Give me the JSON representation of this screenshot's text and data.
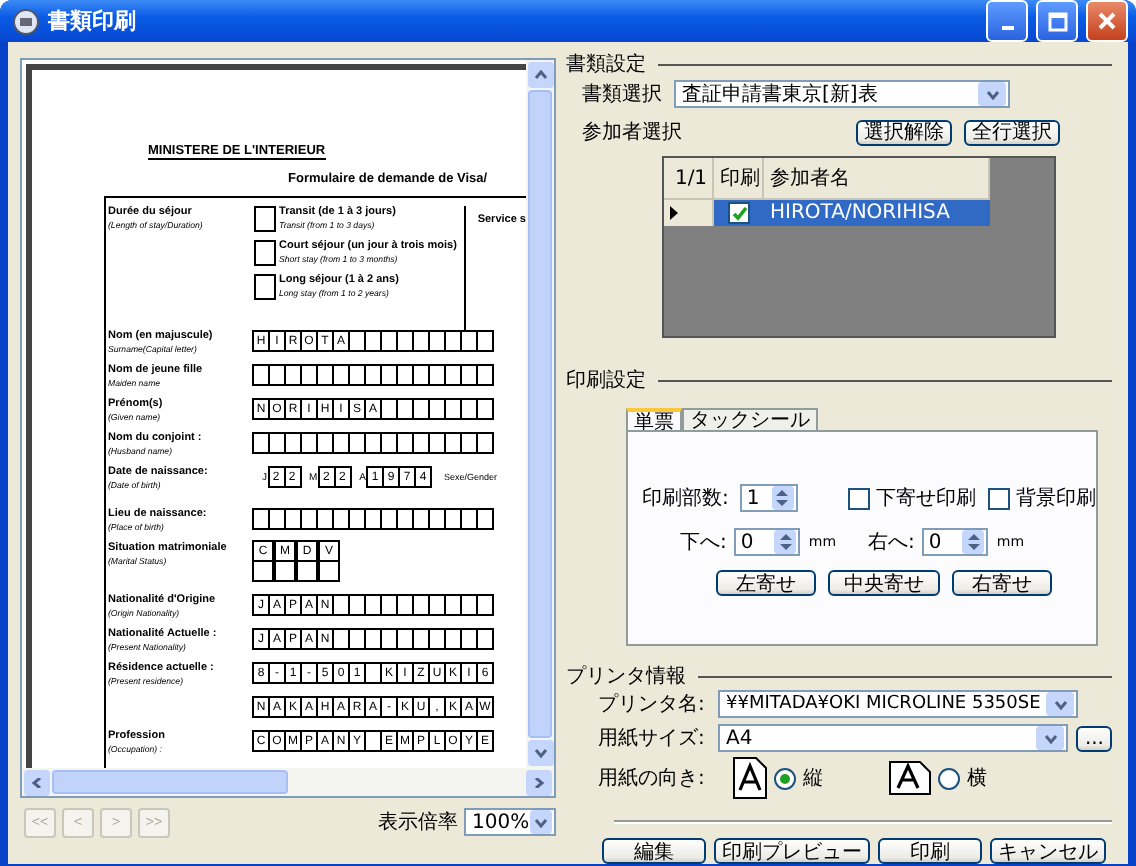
{
  "window": {
    "title": "書類印刷"
  },
  "preview": {
    "document": {
      "heading": "MINISTERE DE L'INTERIEUR",
      "form_title": "Formulaire de demande de Visa/",
      "stay": {
        "label": "Durée du séjour",
        "sublabel": "(Length of stay/Duration)",
        "side_label": "Service s",
        "options": [
          {
            "label": "Transit (de 1 à 3 jours)",
            "sublabel": "Transit (from 1 to 3 days)",
            "checked": false
          },
          {
            "label": "Court séjour (un jour à trois mois)",
            "sublabel": "Short stay (from 1 to 3 months)",
            "checked": false
          },
          {
            "label": "Long séjour (1 à 2 ans)",
            "sublabel": "Long stay (from 1 to 2 years)",
            "checked": false
          }
        ]
      },
      "fields": [
        {
          "kind": "boxes",
          "label": "Nom (en majuscule)",
          "sublabel": "Surname(Capital letter)",
          "cells": [
            "H",
            "I",
            "R",
            "O",
            "T",
            "A"
          ]
        },
        {
          "kind": "boxes",
          "label": "Nom de jeune fille",
          "sublabel": "Maiden name"
        },
        {
          "kind": "boxes",
          "label": "Prénom(s)",
          "sublabel": "(Given name)",
          "cells": [
            "N",
            "O",
            "R",
            "I",
            "H",
            "I",
            "S",
            "A"
          ]
        },
        {
          "kind": "boxes",
          "label": "Nom du conjoint :",
          "sublabel": "(Husband name)"
        },
        {
          "kind": "date",
          "label": "Date de naissance:",
          "sublabel": "(Date of birth)",
          "parts": [
            {
              "prefix": "J",
              "cells": [
                "2",
                "2"
              ]
            },
            {
              "prefix": "M",
              "cells": [
                "2",
                "2"
              ]
            },
            {
              "prefix": "A",
              "cells": [
                "1",
                "9",
                "7",
                "4"
              ]
            }
          ],
          "trailing": "Sexe/Gender"
        },
        {
          "kind": "boxes",
          "label": "Lieu de naissance:",
          "sublabel": "(Place of birth)"
        },
        {
          "kind": "grid",
          "label": "Situation matrimoniale",
          "sublabel": "(Marital Status)",
          "cells": [
            "C",
            "M",
            "D",
            "V"
          ]
        },
        {
          "kind": "boxes",
          "label": "Nationalité d'Origine",
          "sublabel": "(Origin Nationality)",
          "cells": [
            "J",
            "A",
            "P",
            "A",
            "N"
          ]
        },
        {
          "kind": "boxes",
          "label": "Nationalité Actuelle :",
          "sublabel": "(Present Nationality)",
          "cells": [
            "J",
            "A",
            "P",
            "A",
            "N"
          ]
        },
        {
          "kind": "boxes",
          "label": "Résidence actuelle :",
          "sublabel": "(Present residence)",
          "cells": [
            "8",
            "-",
            "1",
            "-",
            "5",
            "0",
            "1",
            "",
            "K",
            "I",
            "Z",
            "U",
            "K",
            "I",
            "6"
          ]
        },
        {
          "kind": "boxes",
          "cells": [
            "N",
            "A",
            "K",
            "A",
            "H",
            "A",
            "R",
            "A",
            "-",
            "K",
            "U",
            ",",
            "K",
            "A",
            "W"
          ]
        },
        {
          "kind": "boxes",
          "label": "Profession",
          "sublabel": "(Occupation) :",
          "cells": [
            "C",
            "O",
            "M",
            "P",
            "A",
            "N",
            "Y",
            "",
            "E",
            "M",
            "P",
            "L",
            "O",
            "Y",
            "E"
          ]
        }
      ]
    },
    "nav_buttons": [
      {
        "label": "<<",
        "disabled": true
      },
      {
        "label": "<",
        "disabled": true
      },
      {
        "label": ">",
        "disabled": true
      },
      {
        "label": ">>",
        "disabled": true
      }
    ],
    "zoom": {
      "label": "表示倍率",
      "value": "100%"
    }
  },
  "document_settings": {
    "title": "書類設定",
    "document_label": "書類選択",
    "document_value": "査証申請書東京[新]表",
    "participants_label": "参加者選択",
    "buttons": [
      "選択解除",
      "全行選択"
    ],
    "table": {
      "columns": [
        "1/1",
        "印刷",
        "参加者名"
      ],
      "rows": [
        {
          "print": true,
          "name": "HIROTA/NORIHISA",
          "selected": true
        }
      ]
    }
  },
  "print_settings": {
    "title": "印刷設定",
    "tabs": [
      {
        "label": "単票",
        "selected": true
      },
      {
        "label": "タックシール",
        "selected": false
      }
    ],
    "copies_label": "印刷部数:",
    "copies_value": "1",
    "options": [
      {
        "label": "下寄せ印刷",
        "checked": false
      },
      {
        "label": "背景印刷",
        "checked": false
      }
    ],
    "offsets": [
      {
        "label": "下へ:",
        "value": "0",
        "unit": "mm"
      },
      {
        "label": "右へ:",
        "value": "0",
        "unit": "mm"
      }
    ],
    "align_buttons": [
      "左寄せ",
      "中央寄せ",
      "右寄せ"
    ]
  },
  "printer": {
    "title": "プリンタ情報",
    "name_label": "プリンタ名:",
    "name_value": "¥¥MITADA¥OKI MICROLINE 5350SE",
    "paper_label": "用紙サイズ:",
    "paper_value": "A4",
    "paper_button": "...",
    "orientation_label": "用紙の向き:",
    "orientations": [
      {
        "kind": "portrait",
        "label": "縦",
        "selected": true
      },
      {
        "kind": "landscape",
        "label": "横",
        "selected": false
      }
    ]
  },
  "footer_buttons": [
    "編集",
    "印刷プレビュー",
    "印刷",
    "キャンセル"
  ]
}
